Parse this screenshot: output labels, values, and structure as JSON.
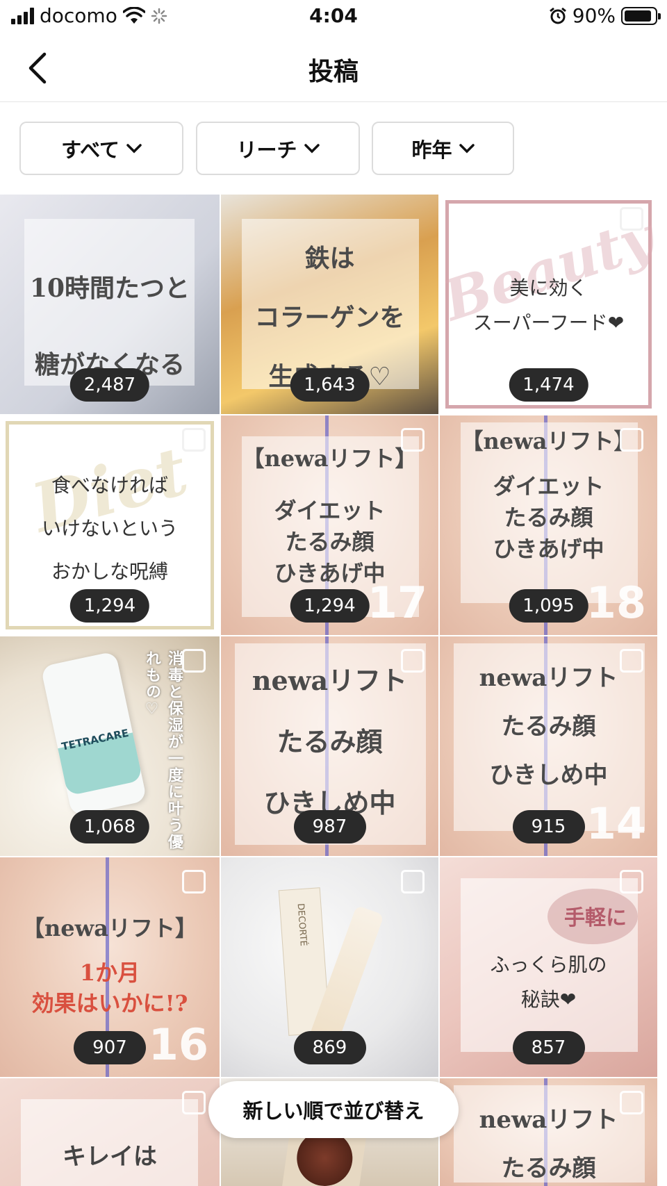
{
  "status_bar": {
    "carrier": "docomo",
    "time": "4:04",
    "battery_pct": "90%",
    "battery_level": 0.9
  },
  "nav": {
    "title": "投稿"
  },
  "filters": [
    {
      "label": "すべて"
    },
    {
      "label": "リーチ"
    },
    {
      "label": "昨年"
    }
  ],
  "posts": [
    {
      "count": "2,487",
      "lines": [
        "10時間たつと",
        "糖がなくなる"
      ]
    },
    {
      "count": "1,643",
      "lines": [
        "鉄は",
        "コラーゲンを",
        "生成する♡"
      ]
    },
    {
      "count": "1,474",
      "lines": [
        "美に効く",
        "スーパーフード❤"
      ],
      "script": "Beauty"
    },
    {
      "count": "1,294",
      "lines": [
        "食べなければ",
        "いけないという",
        "おかしな呪縛"
      ],
      "script": "Diet"
    },
    {
      "count": "1,294",
      "lines": [
        "【newaリフト】",
        "ダイエット",
        "たるみ顔",
        "ひきあげ中"
      ],
      "badge": "17"
    },
    {
      "count": "1,095",
      "lines": [
        "【newaリフト】",
        "ダイエット",
        "たるみ顔",
        "ひきあげ中"
      ],
      "badge": "18"
    },
    {
      "count": "1,068",
      "lines": [
        "TETRACARE"
      ],
      "caption": "消毒と保湿が一度に叶う優れもの♡"
    },
    {
      "count": "987",
      "lines": [
        "newaリフト",
        "たるみ顔",
        "ひきしめ中"
      ]
    },
    {
      "count": "915",
      "lines": [
        "newaリフト",
        "たるみ顔",
        "ひきしめ中"
      ],
      "badge": "14"
    },
    {
      "count": "907",
      "lines": [
        "【newaリフト】",
        "1か月",
        "効果はいかに!?"
      ],
      "badge": "16"
    },
    {
      "count": "869",
      "lines": [
        "DECORTÉ"
      ]
    },
    {
      "count": "857",
      "lines": [
        "手軽に",
        "ふっくら肌の",
        "秘訣❤"
      ]
    },
    {
      "count": "",
      "lines": [
        "キレイは"
      ]
    },
    {
      "count": "",
      "lines": []
    },
    {
      "count": "",
      "lines": [
        "newaリフト",
        "たるみ顔"
      ]
    }
  ],
  "sort_button": {
    "label": "新しい順で並び替え"
  },
  "colors": {
    "pill": "#2a2a2a",
    "accent_red": "#d9503f"
  }
}
